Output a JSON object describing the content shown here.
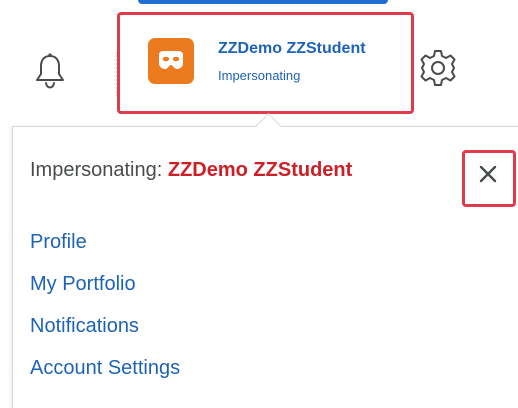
{
  "header": {
    "user_name": "ZZDemo ZZStudent",
    "user_status": "Impersonating",
    "avatar_icon": "mask-icon",
    "avatar_color": "#ec7a1f",
    "notifications_icon": "bell-icon",
    "settings_icon": "gear-icon"
  },
  "dropdown": {
    "impersonating_label": "Impersonating:",
    "impersonated_user": "ZZDemo ZZStudent",
    "close_icon": "close-icon",
    "links": [
      {
        "label": "Profile"
      },
      {
        "label": "My Portfolio"
      },
      {
        "label": "Notifications"
      },
      {
        "label": "Account Settings"
      }
    ]
  },
  "colors": {
    "link": "#1d63b8",
    "impersonated_name": "#cd2026",
    "highlight": "#e03b4b",
    "accent_strip": "#1f6fd1"
  }
}
